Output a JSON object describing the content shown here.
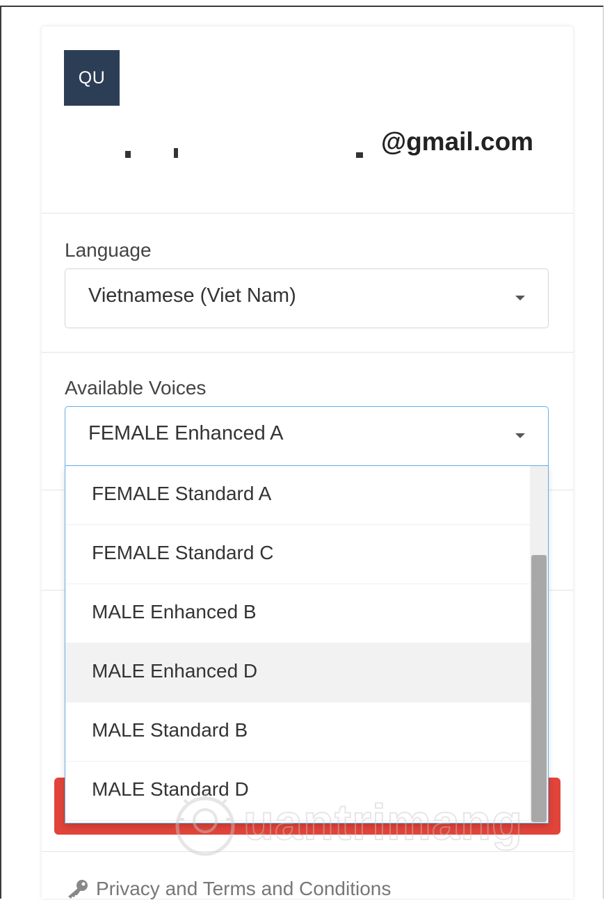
{
  "account": {
    "avatar_initials": "QU",
    "email_visible": "@gmail.com"
  },
  "language": {
    "label": "Language",
    "selected": "Vietnamese (Viet Nam)"
  },
  "voices": {
    "label": "Available Voices",
    "selected": "FEMALE Enhanced A",
    "options": [
      {
        "label": "FEMALE Standard A"
      },
      {
        "label": "FEMALE Standard C"
      },
      {
        "label": "MALE Enhanced B"
      },
      {
        "label": "MALE Enhanced D",
        "hovered": true
      },
      {
        "label": "MALE Standard B"
      },
      {
        "label": "MALE Standard D"
      }
    ],
    "scroll_position": 0.25
  },
  "footer": {
    "privacy_link": "Privacy and Terms and Conditions",
    "icon": "key-icon"
  },
  "watermark": {
    "text": "uantrimang",
    "icon": "lightbulb-icon"
  },
  "colors": {
    "avatar_bg": "#2c3e55",
    "focus_border": "#66afe9",
    "highlight_red": "#e0443a",
    "hover_bg": "#f2f2f2",
    "scroll_thumb": "#a8a8a8"
  }
}
